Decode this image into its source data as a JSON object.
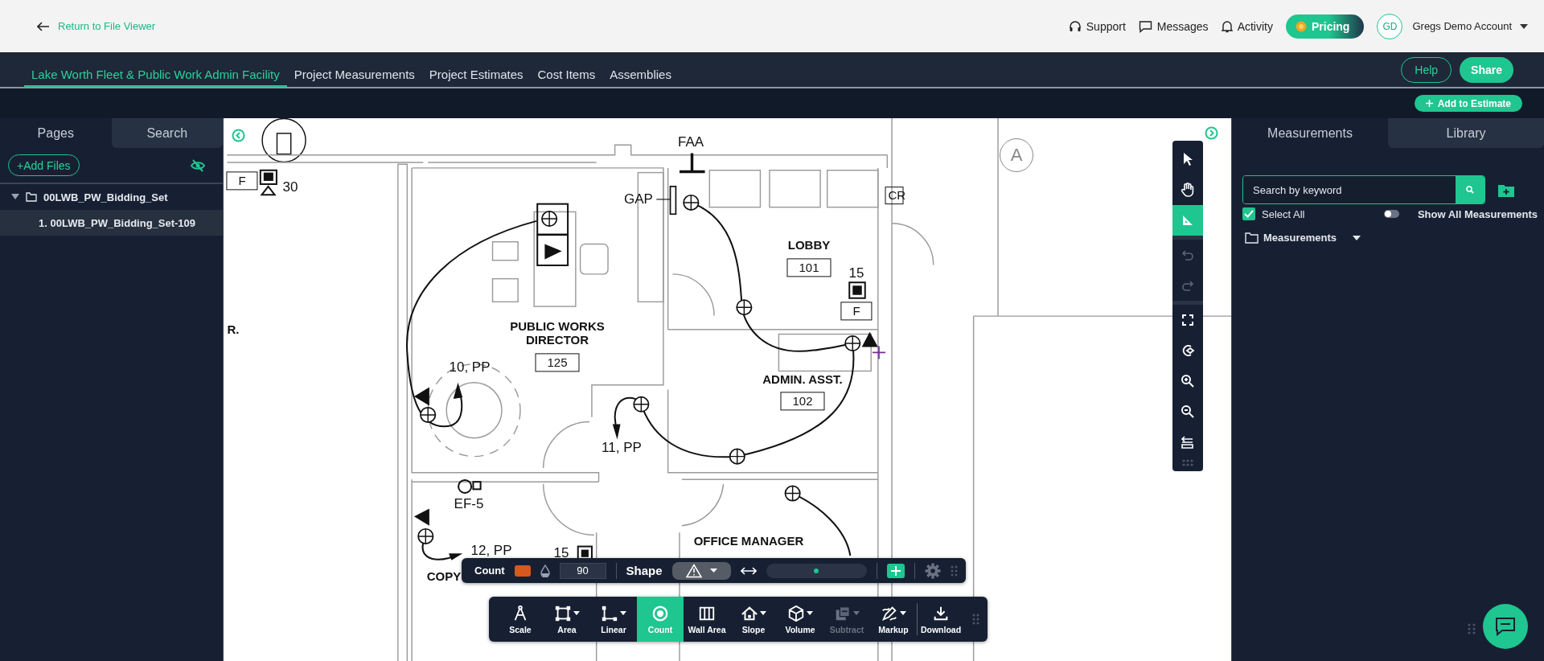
{
  "header": {
    "back_link": "Return to File Viewer",
    "links": [
      {
        "kind": "support",
        "label": "Support"
      },
      {
        "kind": "messages",
        "label": "Messages"
      },
      {
        "kind": "activity",
        "label": "Activity"
      }
    ],
    "pricing": "Pricing",
    "avatar": "GD",
    "account": "Gregs Demo Account"
  },
  "nav": {
    "tabs": [
      {
        "label": "Lake Worth Fleet & Public Work Admin Facility",
        "selected": true
      },
      {
        "label": "Project Measurements",
        "selected": false
      },
      {
        "label": "Project Estimates",
        "selected": false
      },
      {
        "label": "Cost Items",
        "selected": false
      },
      {
        "label": "Assemblies",
        "selected": false
      }
    ],
    "help": "Help",
    "share": "Share",
    "add_to_estimate": "Add to Estimate"
  },
  "left_panel": {
    "tabs": [
      {
        "label": "Pages",
        "selected": true
      },
      {
        "label": "Search",
        "selected": false
      }
    ],
    "add_files": "+Add Files",
    "tree": [
      {
        "label": "00LWB_PW_Bidding_Set",
        "expanded": true,
        "selected": false,
        "children": [
          {
            "label": "1.  00LWB_PW_Bidding_Set-109",
            "selected": true
          }
        ]
      }
    ]
  },
  "plan": {
    "grid_bubble": "A",
    "labels": [
      "FAA",
      "GAP",
      "CR",
      "LOBBY",
      "101",
      "15",
      "F",
      "PUBLIC WORKS\nDIRECTOR",
      "125",
      "10, PP",
      "11, PP",
      "ADMIN. ASST.",
      "102",
      "EF-5",
      "12, PP",
      "15",
      "OFFICE MANAGER",
      "COPY",
      "F",
      "30",
      "R."
    ]
  },
  "vertical_tools": [
    [
      {
        "kind": "pointer",
        "selected": false,
        "disabled": false
      },
      {
        "kind": "hand",
        "selected": false,
        "disabled": false
      },
      {
        "kind": "ruler",
        "selected": true,
        "disabled": false
      }
    ],
    [
      {
        "kind": "undo",
        "selected": false,
        "disabled": true
      },
      {
        "kind": "redo",
        "selected": false,
        "disabled": true
      }
    ],
    [
      {
        "kind": "fit",
        "selected": false,
        "disabled": false
      },
      {
        "kind": "rotate",
        "selected": false,
        "disabled": false
      },
      {
        "kind": "zoom-in",
        "selected": false,
        "disabled": false
      },
      {
        "kind": "zoom-out",
        "selected": false,
        "disabled": false
      },
      {
        "kind": "toolbar",
        "selected": false,
        "disabled": false
      }
    ]
  ],
  "count_bar": {
    "label": "Count",
    "color": "#d9581e",
    "opacity": "90",
    "shape_label": "Shape",
    "level": 0.5
  },
  "tools": [
    {
      "kind": "scale",
      "label": "Scale",
      "selected": false,
      "disabled": false,
      "dropdown": false
    },
    {
      "kind": "area",
      "label": "Area",
      "selected": false,
      "disabled": false,
      "dropdown": true
    },
    {
      "kind": "linear",
      "label": "Linear",
      "selected": false,
      "disabled": false,
      "dropdown": true
    },
    {
      "kind": "count",
      "label": "Count",
      "selected": true,
      "disabled": false,
      "dropdown": false
    },
    {
      "kind": "wall",
      "label": "Wall Area",
      "selected": false,
      "disabled": false,
      "dropdown": false
    },
    {
      "kind": "slope",
      "label": "Slope",
      "selected": false,
      "disabled": false,
      "dropdown": true
    },
    {
      "kind": "volume",
      "label": "Volume",
      "selected": false,
      "disabled": false,
      "dropdown": true
    },
    {
      "kind": "subtract",
      "label": "Subtract",
      "selected": false,
      "disabled": true,
      "dropdown": true
    },
    {
      "kind": "markup",
      "label": "Markup",
      "selected": false,
      "disabled": false,
      "dropdown": true
    },
    {
      "kind": "download",
      "label": "Download",
      "selected": false,
      "disabled": false,
      "dropdown": false
    }
  ],
  "right_panel": {
    "tabs": [
      {
        "label": "Measurements",
        "selected": true
      },
      {
        "label": "Library",
        "selected": false
      }
    ],
    "search_placeholder": "Search by keyword",
    "select_all": {
      "label": "Select All",
      "checked": true
    },
    "show_all": {
      "label": "Show All Measurements",
      "on": false
    },
    "folder": "Measurements"
  }
}
